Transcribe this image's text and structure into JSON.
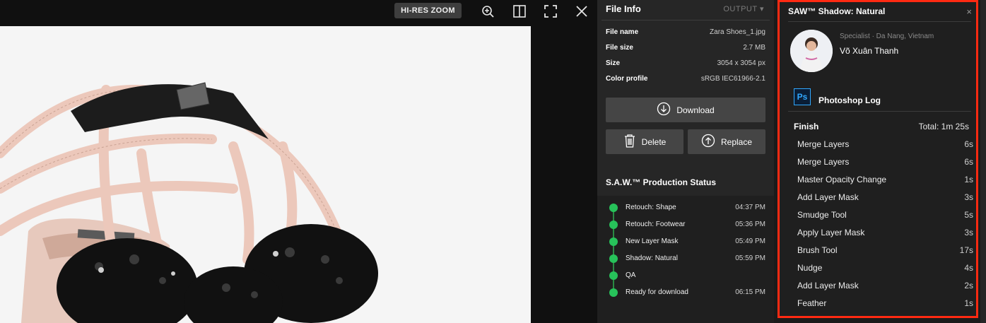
{
  "viewer": {
    "hires_zoom_label": "HI-RES ZOOM"
  },
  "file_info": {
    "title": "File Info",
    "output_label": "OUTPUT",
    "rows": [
      {
        "key": "File name",
        "value": "Zara Shoes_1.jpg"
      },
      {
        "key": "File size",
        "value": "2.7 MB"
      },
      {
        "key": "Size",
        "value": "3054 x 3054 px"
      },
      {
        "key": "Color profile",
        "value": "sRGB IEC61966-2.1"
      }
    ],
    "download_label": "Download",
    "delete_label": "Delete",
    "replace_label": "Replace"
  },
  "production": {
    "title": "S.A.W.™ Production Status",
    "steps": [
      {
        "label": "Retouch: Shape",
        "time": "04:37 PM"
      },
      {
        "label": "Retouch: Footwear",
        "time": "05:36 PM"
      },
      {
        "label": "New Layer Mask",
        "time": "05:49 PM"
      },
      {
        "label": "Shadow: Natural",
        "time": "05:59 PM"
      },
      {
        "label": "QA",
        "time": ""
      },
      {
        "label": "Ready for download",
        "time": "06:15 PM"
      }
    ],
    "status_color": "#27c25a"
  },
  "log_panel": {
    "title": "SAW™ Shadow: Natural",
    "close_glyph": "×",
    "specialist_role": "Specialist · Da Nang, Vietnam",
    "specialist_name": "Võ Xuân Thanh",
    "ps_badge": "Ps",
    "log_title": "Photoshop Log",
    "finish_label": "Finish",
    "total_label": "Total: 1m 25s",
    "items": [
      {
        "label": "Merge Layers",
        "duration": "6s"
      },
      {
        "label": "Merge Layers",
        "duration": "6s"
      },
      {
        "label": "Master Opacity Change",
        "duration": "1s"
      },
      {
        "label": "Add Layer Mask",
        "duration": "3s"
      },
      {
        "label": "Smudge Tool",
        "duration": "5s"
      },
      {
        "label": "Apply Layer Mask",
        "duration": "3s"
      },
      {
        "label": "Brush Tool",
        "duration": "17s"
      },
      {
        "label": "Nudge",
        "duration": "4s"
      },
      {
        "label": "Add Layer Mask",
        "duration": "2s"
      },
      {
        "label": "Feather",
        "duration": "1s"
      }
    ],
    "highlight_color": "#ff2a12"
  },
  "icons": [
    "zoom-in-icon",
    "split-view-icon",
    "fullscreen-icon",
    "close-icon",
    "download-icon",
    "trash-icon",
    "upload-icon",
    "chevron-down-icon"
  ]
}
